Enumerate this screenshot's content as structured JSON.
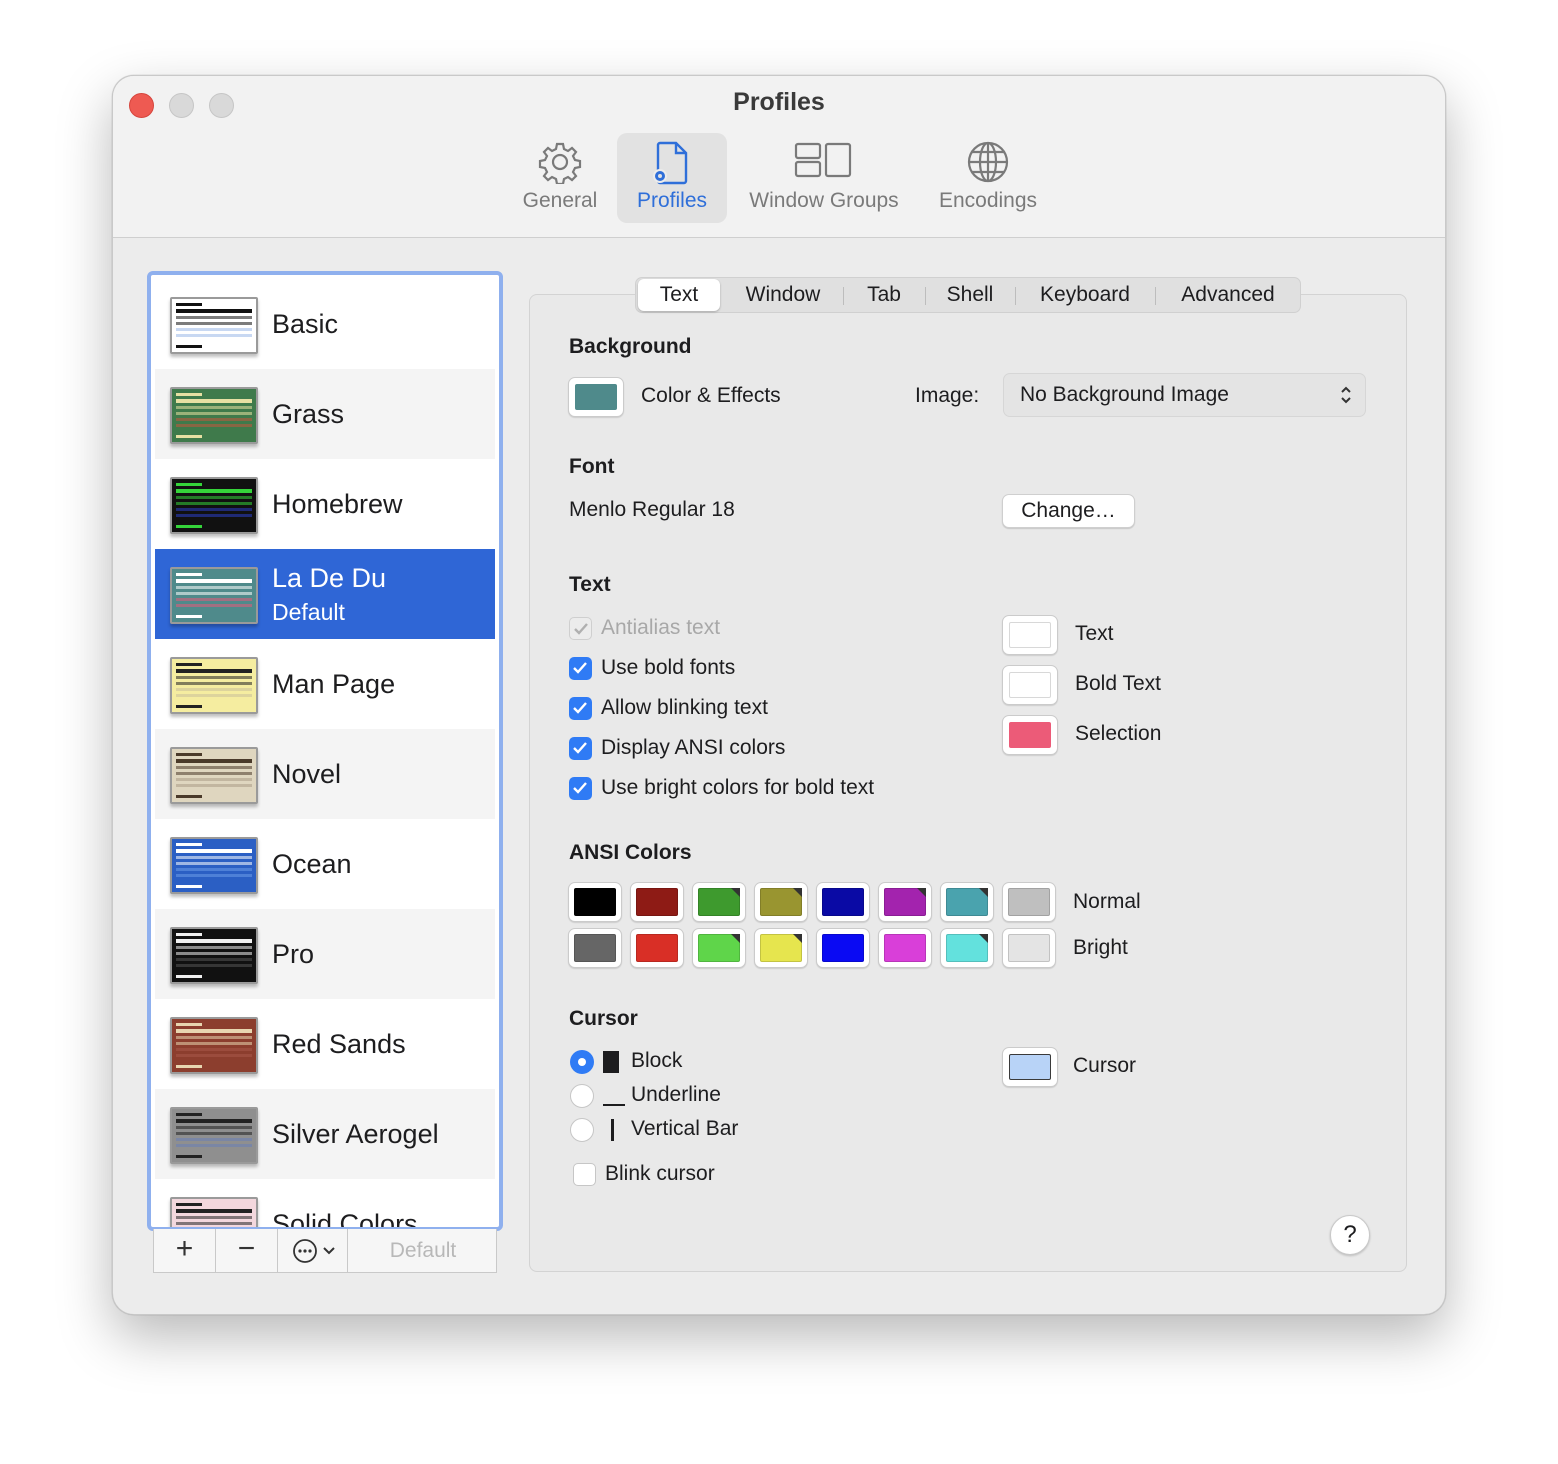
{
  "window": {
    "title": "Profiles"
  },
  "toolbar": {
    "general": "General",
    "profiles": "Profiles",
    "window_groups": "Window Groups",
    "encodings": "Encodings"
  },
  "profiles": [
    {
      "name": "Basic",
      "bg": "#ffffff",
      "fg": "#111111",
      "accent": "#9ab8e8"
    },
    {
      "name": "Grass",
      "bg": "#3f7a4b",
      "fg": "#e7e0a3",
      "accent": "#c4563e"
    },
    {
      "name": "Homebrew",
      "bg": "#111111",
      "fg": "#35d43a",
      "accent": "#2b3fc8"
    },
    {
      "name": "La De Du",
      "sub": "Default",
      "bg": "#4f8a8b",
      "fg": "#ffffff",
      "accent": "#e85a7a"
    },
    {
      "name": "Man Page",
      "bg": "#f5eda0",
      "fg": "#222222",
      "accent": "#c9c09a"
    },
    {
      "name": "Novel",
      "bg": "#dfd6bf",
      "fg": "#4a3a2a",
      "accent": "#a99d87"
    },
    {
      "name": "Ocean",
      "bg": "#2b5fc4",
      "fg": "#ffffff",
      "accent": "#6c9ae8"
    },
    {
      "name": "Pro",
      "bg": "#111111",
      "fg": "#f0f0f0",
      "accent": "#555555"
    },
    {
      "name": "Red Sands",
      "bg": "#8c3e2e",
      "fg": "#e8d6b0",
      "accent": "#a8584a"
    },
    {
      "name": "Silver Aerogel",
      "bg": "#8f8f8f",
      "fg": "#222222",
      "accent": "#6a7fb8"
    },
    {
      "name": "Solid Colors",
      "bg": "#f3d7dd",
      "fg": "#222222",
      "accent": "#9ab8e8"
    }
  ],
  "list_buttons": {
    "add": "+",
    "remove": "−",
    "default": "Default"
  },
  "tabs": [
    "Text",
    "Window",
    "Tab",
    "Shell",
    "Keyboard",
    "Advanced"
  ],
  "background": {
    "title": "Background",
    "color_effects": "Color & Effects",
    "color": "#4f8a8b",
    "image_label": "Image:",
    "image_value": "No Background Image"
  },
  "font": {
    "title": "Font",
    "value": "Menlo Regular 18",
    "change": "Change…"
  },
  "text": {
    "title": "Text",
    "antialias": "Antialias text",
    "bold_fonts": "Use bold fonts",
    "blinking": "Allow blinking text",
    "ansi": "Display ANSI colors",
    "bright_bold": "Use bright colors for bold text",
    "text_color_label": "Text",
    "bold_color_label": "Bold Text",
    "selection_label": "Selection",
    "text_color": "#ffffff",
    "bold_color": "#ffffff",
    "selection_color": "#ec5b78"
  },
  "ansi": {
    "title": "ANSI Colors",
    "normal_label": "Normal",
    "bright_label": "Bright",
    "normal": [
      "#000000",
      "#8e1b15",
      "#3e9a2e",
      "#999530",
      "#0a0aa5",
      "#a323ae",
      "#4aa3ae",
      "#bfbfbf"
    ],
    "bright": [
      "#666666",
      "#d92f26",
      "#5fd54a",
      "#e6e54e",
      "#0a0af3",
      "#d93fd9",
      "#63e1dd",
      "#e4e4e4"
    ]
  },
  "cursor": {
    "title": "Cursor",
    "block": "Block",
    "underline": "Underline",
    "vertical_bar": "Vertical Bar",
    "blink": "Blink cursor",
    "color_label": "Cursor",
    "color": "#b8d3f7"
  },
  "help": "?"
}
